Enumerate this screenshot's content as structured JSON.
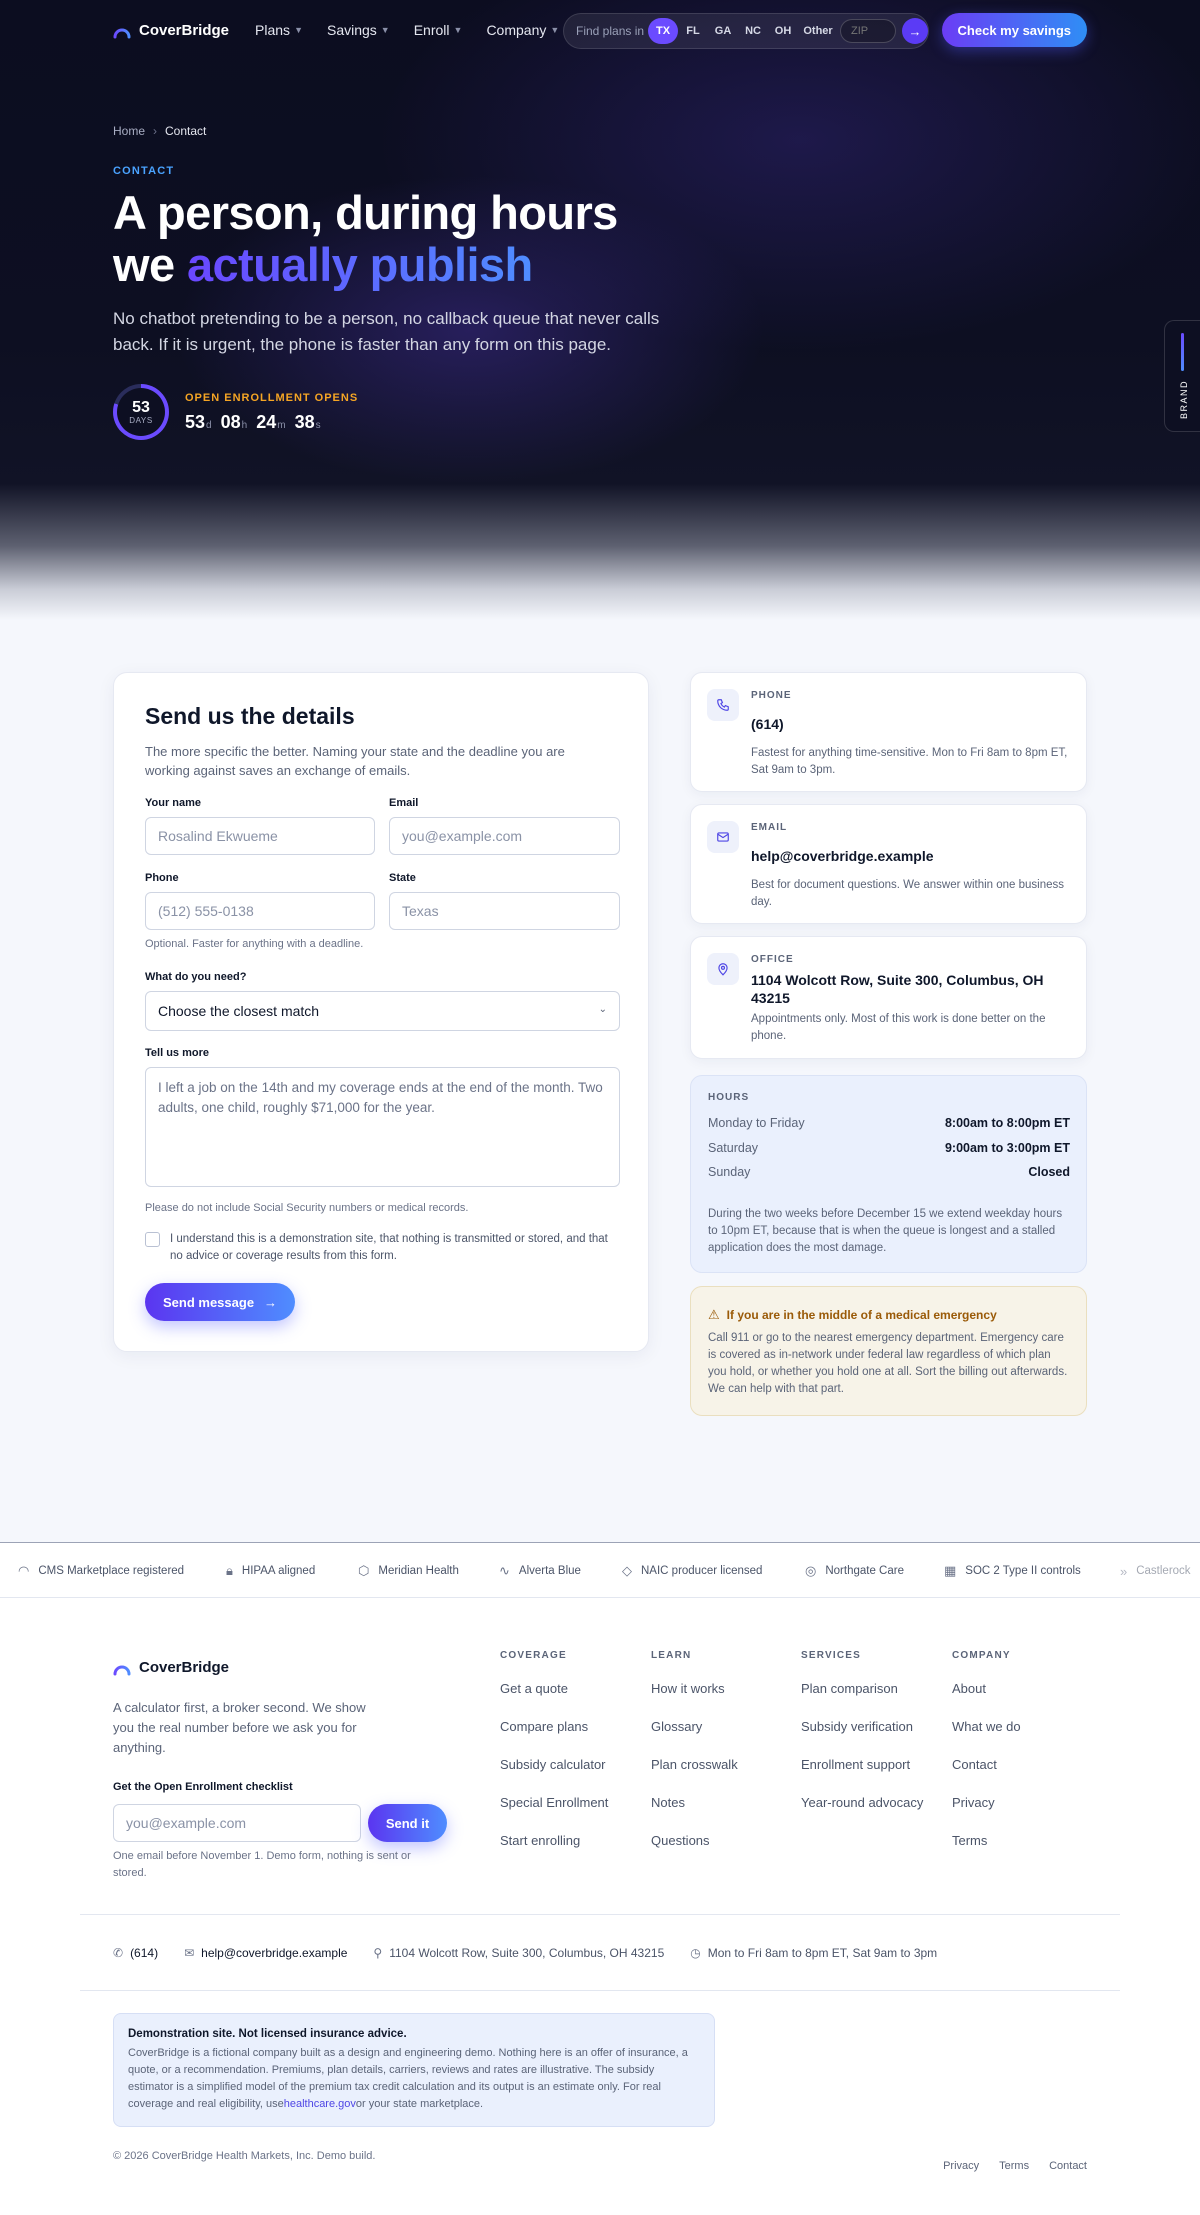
{
  "nav": {
    "brand": "CoverBridge",
    "links": [
      {
        "label": "Plans"
      },
      {
        "label": "Savings"
      },
      {
        "label": "Enroll"
      },
      {
        "label": "Company"
      }
    ],
    "find_plans_label": "Find plans in",
    "states": [
      "TX",
      "FL",
      "GA",
      "NC",
      "OH",
      "Other"
    ],
    "active_state": "TX",
    "zip_placeholder": "ZIP",
    "cta": "Check my savings"
  },
  "hero": {
    "breadcrumb_home": "Home",
    "breadcrumb_current": "Contact",
    "eyebrow": "CONTACT",
    "title_line1": "A person, during hours",
    "title_we": "we",
    "title_highlight": "actually publish",
    "lede": "No chatbot pretending to be a person, no callback queue that never calls back. If it is urgent, the phone is faster than any form on this page.",
    "countdown": {
      "ring_value": "53",
      "ring_label": "DAYS",
      "title": "OPEN ENROLLMENT OPENS",
      "days": "53",
      "days_unit": "d",
      "hours": "08",
      "hours_unit": "h",
      "minutes": "24",
      "minutes_unit": "m",
      "seconds": "38",
      "seconds_unit": "s"
    },
    "brand_tab": "BRAND"
  },
  "form": {
    "title": "Send us the details",
    "subtitle": "The more specific the better. Naming your state and the deadline you are working against saves an exchange of emails.",
    "name_label": "Your name",
    "name_placeholder": "Rosalind Ekwueme",
    "email_label": "Email",
    "email_placeholder": "you@example.com",
    "phone_label": "Phone",
    "phone_placeholder": "(512) 555-0138",
    "state_label": "State",
    "state_placeholder": "Texas",
    "phone_hint": "Optional. Faster for anything with a deadline.",
    "need_label": "What do you need?",
    "need_value": "Choose the closest match",
    "more_label": "Tell us more",
    "more_placeholder": "I left a job on the 14th and my coverage ends at the end of the month. Two adults, one child, roughly $71,000 for the year.",
    "more_hint": "Please do not include Social Security numbers or medical records.",
    "consent": "I understand this is a demonstration site, that nothing is transmitted or stored, and that no advice or coverage results from this form.",
    "submit": "Send message"
  },
  "contact": {
    "phone": {
      "label": "PHONE",
      "value": "(614)",
      "desc": "Fastest for anything time-sensitive. Mon to Fri 8am to 8pm ET, Sat 9am to 3pm."
    },
    "email": {
      "label": "EMAIL",
      "value": "help@coverbridge.example",
      "desc": "Best for document questions. We answer within one business day."
    },
    "office": {
      "label": "OFFICE",
      "value": "1104 Wolcott Row, Suite 300, Columbus, OH 43215",
      "desc": "Appointments only. Most of this work is done better on the phone."
    }
  },
  "hours": {
    "label": "HOURS",
    "rows": [
      {
        "day": "Monday to Friday",
        "time": "8:00am to 8:00pm ET"
      },
      {
        "day": "Saturday",
        "time": "9:00am to 3:00pm ET"
      },
      {
        "day": "Sunday",
        "time": "Closed"
      }
    ],
    "note": "During the two weeks before December 15 we extend weekday hours to 10pm ET, because that is when the queue is longest and a stalled application does the most damage."
  },
  "emergency": {
    "title": "If you are in the middle of a medical emergency",
    "body": "Call 911 or go to the nearest emergency department. Emergency care is covered as in-network under federal law regardless of which plan you hold, or whether you hold one at all. Sort the billing out afterwards. We can help with that part."
  },
  "trust": [
    {
      "icon": "arc-icon",
      "label": "CMS Marketplace registered"
    },
    {
      "icon": "lock-icon",
      "label": "HIPAA aligned"
    },
    {
      "icon": "hexagon-icon",
      "label": "Meridian Health"
    },
    {
      "icon": "wave-icon",
      "label": "Alverta Blue"
    },
    {
      "icon": "diamond-icon",
      "label": "NAIC producer licensed"
    },
    {
      "icon": "target-icon",
      "label": "Northgate Care"
    },
    {
      "icon": "grid-icon",
      "label": "SOC 2 Type II controls"
    },
    {
      "icon": "double-chevron-icon",
      "label": "Castlerock"
    }
  ],
  "footer": {
    "brand": "CoverBridge",
    "tagline": "A calculator first, a broker second. We show you the real number before we ask you for anything.",
    "newsletter_label": "Get the Open Enrollment checklist",
    "newsletter_placeholder": "you@example.com",
    "newsletter_button": "Send it",
    "newsletter_hint": "One email before November 1. Demo form, nothing is sent or stored.",
    "columns": [
      {
        "title": "COVERAGE",
        "links": [
          "Get a quote",
          "Compare plans",
          "Subsidy calculator",
          "Special Enrollment",
          "Start enrolling"
        ]
      },
      {
        "title": "LEARN",
        "links": [
          "How it works",
          "Glossary",
          "Plan crosswalk",
          "Notes",
          "Questions"
        ]
      },
      {
        "title": "SERVICES",
        "links": [
          "Plan comparison",
          "Subsidy verification",
          "Enrollment support",
          "Year-round advocacy"
        ]
      },
      {
        "title": "COMPANY",
        "links": [
          "About",
          "What we do",
          "Contact",
          "Privacy",
          "Terms"
        ]
      }
    ],
    "contact_phone": "(614)",
    "contact_email": "help@coverbridge.example",
    "contact_address": "1104 Wolcott Row, Suite 300, Columbus, OH 43215",
    "contact_hours": "Mon to Fri 8am to 8pm ET, Sat 9am to 3pm",
    "disclaimer_title": "Demonstration site. Not licensed insurance advice.",
    "disclaimer_body": "CoverBridge is a fictional company built as a design and engineering demo. Nothing here is an offer of insurance, a quote, or a recommendation. Premiums, plan details, carriers, reviews and rates are illustrative. The subsidy estimator is a simplified model of the premium tax credit calculation and its output is an estimate only. For real coverage and real eligibility, use",
    "disclaimer_link": "healthcare.gov",
    "disclaimer_tail": "or your state marketplace.",
    "copyright": "© 2026 CoverBridge Health Markets, Inc. Demo build.",
    "legal": [
      "Privacy",
      "Terms",
      "Contact"
    ]
  },
  "colors": {
    "accent": "#6b4bff",
    "accent_blue": "#4f8dff",
    "hero_bg": "#0d0f22",
    "warning": "#9a5a08"
  }
}
